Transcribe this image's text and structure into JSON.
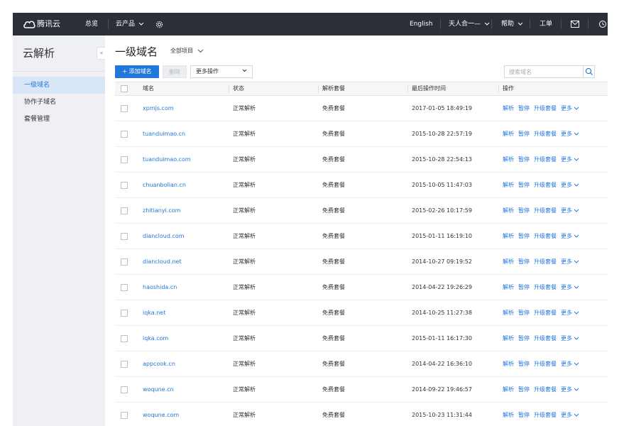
{
  "topbar": {
    "brand": "腾讯云",
    "overview": "总览",
    "products": "云产品",
    "language": "English",
    "account": "天人合一",
    "help": "帮助",
    "ticket": "工单",
    "icons": [
      "cloud-logo-icon",
      "settings-icon",
      "mail-icon",
      "notification-icon"
    ]
  },
  "sidebar": {
    "title": "云解析",
    "collapse": "«",
    "items": [
      {
        "label": "一级域名",
        "active": true
      },
      {
        "label": "协作子域名",
        "active": false
      },
      {
        "label": "套餐管理",
        "active": false
      }
    ]
  },
  "main": {
    "title": "一级域名",
    "project_filter": "全部项目",
    "add_button": "+ 添加域名",
    "delete_button": "删除",
    "more_ops": "更多操作",
    "search_placeholder": "搜索域名"
  },
  "table": {
    "headers": {
      "domain": "域名",
      "status": "状态",
      "plan": "解析套餐",
      "time": "最后操作时间",
      "ops": "操作"
    },
    "actions": [
      "解析",
      "暂停",
      "升级套餐",
      "更多"
    ],
    "rows": [
      {
        "domain": "xpmjs.com",
        "status": "正常解析",
        "plan": "免费套餐",
        "time": "2017-01-05 18:49:19"
      },
      {
        "domain": "tuanduimao.cn",
        "status": "正常解析",
        "plan": "免费套餐",
        "time": "2015-10-28 22:57:19"
      },
      {
        "domain": "tuanduimao.com",
        "status": "正常解析",
        "plan": "免费套餐",
        "time": "2015-10-28 22:54:13"
      },
      {
        "domain": "chuanbolian.cn",
        "status": "正常解析",
        "plan": "免费套餐",
        "time": "2015-10-05 11:47:03"
      },
      {
        "domain": "zhitianyi.com",
        "status": "正常解析",
        "plan": "免费套餐",
        "time": "2015-02-26 10:17:59"
      },
      {
        "domain": "diancloud.com",
        "status": "正常解析",
        "plan": "免费套餐",
        "time": "2015-01-11 16:19:10"
      },
      {
        "domain": "diancloud.net",
        "status": "正常解析",
        "plan": "免费套餐",
        "time": "2014-10-27 09:19:52"
      },
      {
        "domain": "haoshida.cn",
        "status": "正常解析",
        "plan": "免费套餐",
        "time": "2014-04-22 19:26:29"
      },
      {
        "domain": "iqka.net",
        "status": "正常解析",
        "plan": "免费套餐",
        "time": "2014-10-25 11:27:38"
      },
      {
        "domain": "iqka.com",
        "status": "正常解析",
        "plan": "免费套餐",
        "time": "2015-01-11 16:17:30"
      },
      {
        "domain": "appcook.cn",
        "status": "正常解析",
        "plan": "免费套餐",
        "time": "2014-04-22 16:36:10"
      },
      {
        "domain": "woqune.cn",
        "status": "正常解析",
        "plan": "免费套餐",
        "time": "2014-09-22 19:46:57"
      },
      {
        "domain": "woqune.com",
        "status": "正常解析",
        "plan": "免费套餐",
        "time": "2015-10-23 11:31:44"
      }
    ]
  },
  "colors": {
    "topbar": "#2b2f38",
    "accent": "#2277da",
    "sidebar": "#eef0f3",
    "active_nav": "#d8e6f7"
  }
}
